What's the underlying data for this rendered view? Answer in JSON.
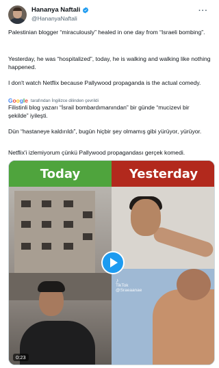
{
  "author": {
    "display_name": "Hananya Naftali",
    "handle": "@HananyaNaftali",
    "verified_color": "#1d9bf0"
  },
  "menu": {
    "more_label": "···"
  },
  "tweet": {
    "p1": "Palestinian blogger “miraculously” healed in one day from “Israeli bombing”.",
    "p2": "Yesterday, he was “hospitalized”, today, he is walking and walking like nothing happened.",
    "p3": "I don't watch Netflix because Pallywood propaganda is the actual comedy."
  },
  "translation": {
    "provider": "Google",
    "note": "tarafından İngilizce dilinden çevrildi",
    "t1": "Filistinli blog yazarı “İsrail bombardımanından” bir günde “mucizevi bir şekilde” iyileşti.",
    "t2": "Dün “hastaneye kaldırıldı”, bugün hiçbir şey olmamış gibi yürüyor, yürüyor.",
    "t3": "Netflix'i izlemiyorum çünkü Pallywood propagandası gerçek komedi."
  },
  "media": {
    "left_label": "Today",
    "right_label": "Yesterday",
    "left_color": "#4fa43d",
    "right_color": "#b2291d",
    "watermark_name": "TikTok",
    "watermark_handle": "@Sraeaanae",
    "duration": "0:23"
  }
}
